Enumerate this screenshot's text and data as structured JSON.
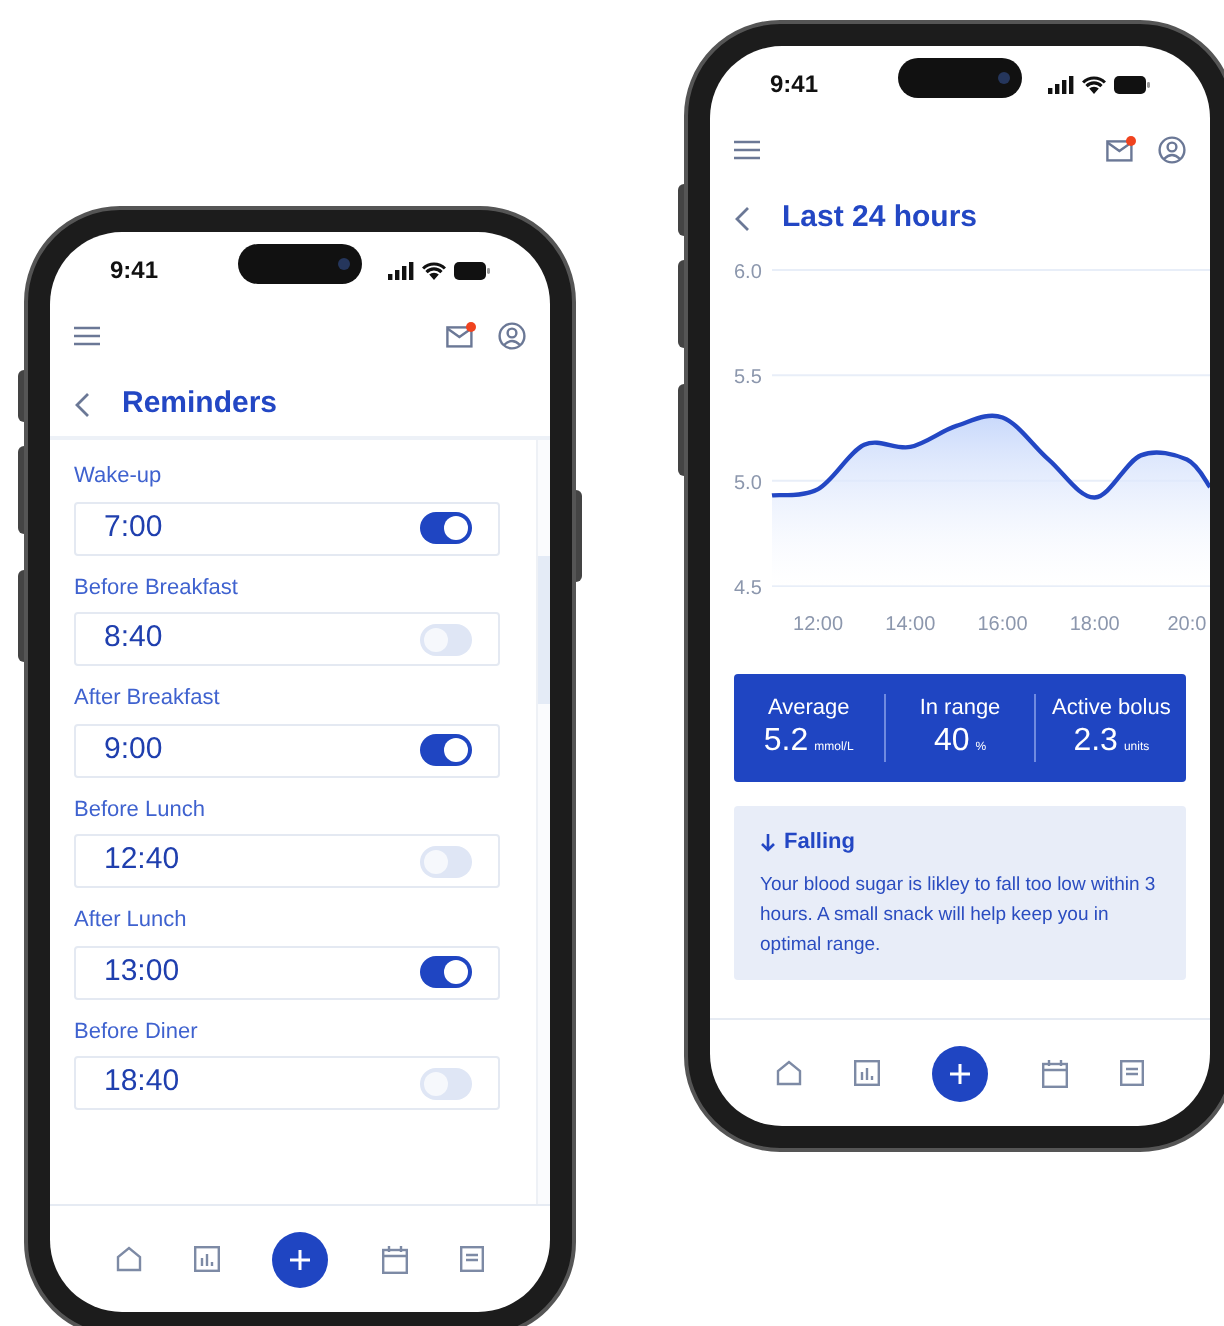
{
  "reminders_screen": {
    "status_time": "9:41",
    "unread": true,
    "title": "Reminders",
    "reminders": [
      {
        "label": "Wake-up",
        "time": "7:00",
        "on": true
      },
      {
        "label": "Before Breakfast",
        "time": "8:40",
        "on": false
      },
      {
        "label": "After Breakfast",
        "time": "9:00",
        "on": true
      },
      {
        "label": "Before Lunch",
        "time": "12:40",
        "on": false
      },
      {
        "label": "After Lunch",
        "time": "13:00",
        "on": true
      },
      {
        "label": "Before Diner",
        "time": "18:40",
        "on": false
      }
    ]
  },
  "trend_screen": {
    "status_time": "9:41",
    "unread": true,
    "title": "Last 24 hours",
    "chart_data": {
      "type": "area",
      "x": [
        11,
        12,
        13,
        14,
        15,
        16,
        17,
        18,
        19,
        20,
        20.5
      ],
      "series": [
        {
          "color": "#2347c4",
          "values": [
            4.93,
            4.96,
            5.17,
            5.16,
            5.26,
            5.3,
            5.1,
            4.92,
            5.12,
            5.1,
            4.97
          ]
        }
      ],
      "xlim": [
        11,
        20.5
      ],
      "ylim": [
        4.5,
        6.0
      ],
      "xticks": [
        {
          "value": 12,
          "label": "12:00"
        },
        {
          "value": 14,
          "label": "14:00"
        },
        {
          "value": 16,
          "label": "16:00"
        },
        {
          "value": 18,
          "label": "18:00"
        },
        {
          "value": 20,
          "label": "20:0"
        }
      ],
      "yticks": [
        {
          "value": 6.0,
          "label": "6.0"
        },
        {
          "value": 5.5,
          "label": "5.5"
        },
        {
          "value": 5.0,
          "label": "5.0"
        },
        {
          "value": 4.5,
          "label": "4.5"
        }
      ]
    },
    "stats": [
      {
        "label": "Average",
        "value": "5.2",
        "unit": "mmol/L"
      },
      {
        "label": "In range",
        "value": "40",
        "unit": "%"
      },
      {
        "label": "Active bolus",
        "value": "2.3",
        "unit": "units"
      }
    ],
    "alert": {
      "title": "Falling",
      "text": "Your blood sugar is likley to fall too low within 3 hours. A small snack will help keep you in optimal range."
    }
  }
}
